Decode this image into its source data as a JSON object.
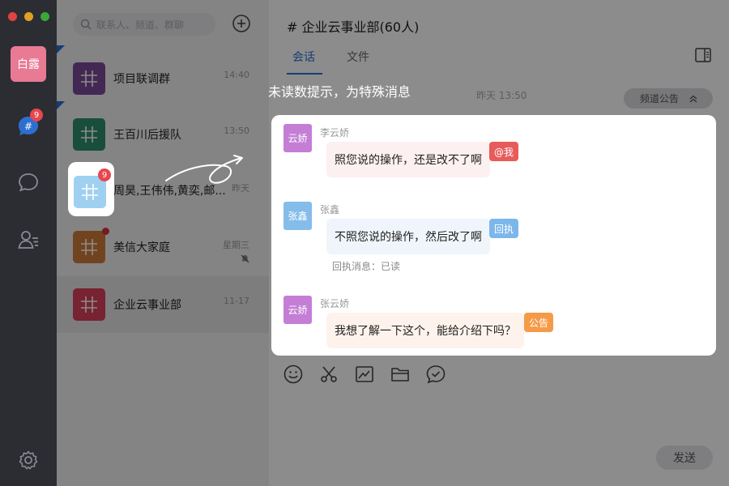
{
  "colors": {
    "rail_bg": "#2b2d33",
    "accent": "#2a6fd4",
    "badge": "#e8464e",
    "tag_mention": "#e85b5b",
    "tag_receipt": "#7cb7ec",
    "tag_notice": "#f59b48"
  },
  "user": {
    "avatar_text": "白露"
  },
  "rail": {
    "channels_badge": "9"
  },
  "search": {
    "placeholder": "联系人、频道、群聊"
  },
  "conversations": [
    {
      "name": "项目联调群",
      "time": "14:40",
      "avatar_color": "#7d4a9a"
    },
    {
      "name": "王百川后援队",
      "time": "13:50",
      "avatar_color": "#2f8f6f"
    },
    {
      "name": "周昊,王伟伟,黄奕,邮...",
      "time": "昨天",
      "avatar_color": "#9fd0f0",
      "badge": "9"
    },
    {
      "name": "美信大家庭",
      "time": "星期三",
      "avatar_color": "#d07a3a"
    },
    {
      "name": "企业云事业部",
      "time": "11-17",
      "avatar_color": "#d9405a"
    }
  ],
  "chat": {
    "title": "# 企业云事业部(60人)",
    "tabs": [
      "会话",
      "文件"
    ],
    "date_label": "昨天 13:50",
    "notice_label": "频道公告",
    "send_label": "发送"
  },
  "hint": {
    "text": "未读数提示，为特殊消息"
  },
  "messages": [
    {
      "avatar_text": "云娇",
      "sender": "李云娇",
      "text": "照您说的操作，还是改不了啊",
      "tag": "@我",
      "avatar_color": "#c47ed6",
      "bubble_color": "#fdf0f0"
    },
    {
      "avatar_text": "张鑫",
      "sender": "张鑫",
      "text": "不照您说的操作，然后改了啊",
      "tag": "回执",
      "receipt": "回执消息：已读",
      "avatar_color": "#84bcea",
      "bubble_color": "#f0f5fc"
    },
    {
      "avatar_text": "云娇",
      "sender": "张云娇",
      "text": "我想了解一下这个，能给介绍下吗？",
      "tag": "公告",
      "avatar_color": "#c47ed6",
      "bubble_color": "#fdf3ec"
    }
  ]
}
